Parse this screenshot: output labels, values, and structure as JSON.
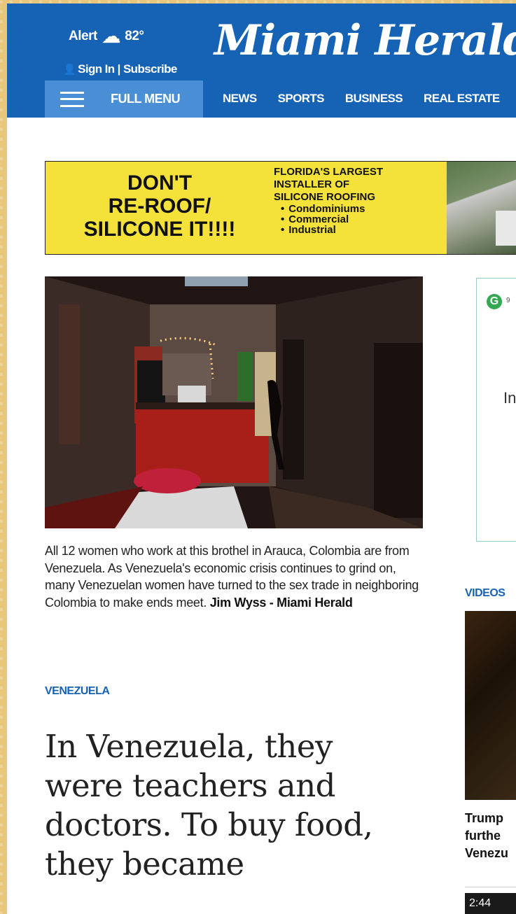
{
  "header": {
    "alert_label": "Alert",
    "temperature": "82°",
    "signin_label": "Sign In | Subscribe",
    "logo_text": "Miami Herald",
    "full_menu_label": "FULL MENU",
    "nav_items": [
      "NEWS",
      "SPORTS",
      "BUSINESS",
      "REAL ESTATE"
    ]
  },
  "ad": {
    "left_line1": "DON'T",
    "left_line2": "RE-ROOF/",
    "left_line3": "SILICONE IT!!!!",
    "right_line1": "FLORIDA'S LARGEST",
    "right_line2": "INSTALLER OF",
    "right_line3": "SILICONE ROOFING",
    "bullets": [
      "Condominiums",
      "Commercial",
      "Industrial"
    ]
  },
  "article": {
    "caption": "All 12 women who work at this brothel in Arauca, Colombia are from Venezuela. As Venezuela's economic crisis continues to grind on, many Venezuelan women have turned to the sex trade in neighboring Colombia to make ends meet.",
    "credit": "Jim Wyss - Miami Herald",
    "section": "VENEZUELA",
    "headline_line1": "In Venezuela, they",
    "headline_line2": "were teachers and",
    "headline_line3": "doctors. To buy food,",
    "headline_line4": "they became"
  },
  "sidebar": {
    "widget_logo_letter": "G",
    "widget_partial_text": "9",
    "widget_partial_heading": "In",
    "videos_label": "VIDEOS",
    "video_title_line1": "Trump",
    "video_title_line2": "furthe",
    "video_title_line3": "Venezu",
    "video_duration": "2:44"
  },
  "colors": {
    "brand_blue": "#1662b4",
    "menu_blue": "#4a8fd6",
    "ad_yellow": "#f4e23a"
  }
}
